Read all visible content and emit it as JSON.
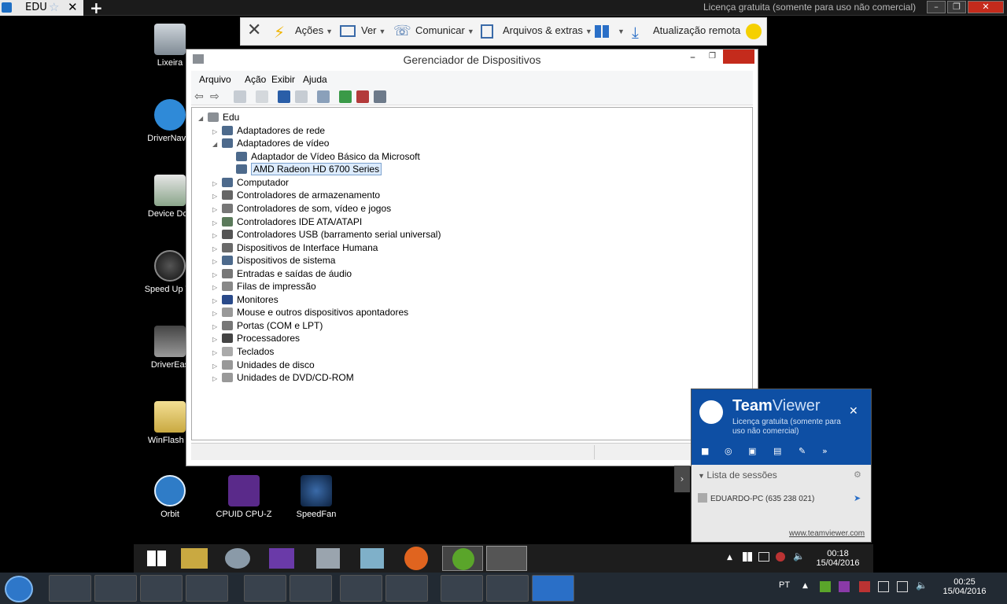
{
  "tabbar": {
    "tab_name": "EDU",
    "license_text": "Licença gratuita (somente para uso não comercial)"
  },
  "toolbar": {
    "actions": "Ações",
    "view": "Ver",
    "communicate": "Comunicar",
    "files": "Arquivos & extras",
    "remote_update": "Atualização remota"
  },
  "desktop_icons": [
    {
      "label": "Lixeira"
    },
    {
      "label": "DriverNavig"
    },
    {
      "label": "Device Doc"
    },
    {
      "label": "Speed Up Th"
    },
    {
      "label": "DriverEas"
    },
    {
      "label": "WinFlash B"
    },
    {
      "label": "Orbit"
    },
    {
      "label": "CPUID CPU-Z"
    },
    {
      "label": "SpeedFan"
    }
  ],
  "device_manager": {
    "title": "Gerenciador de Dispositivos",
    "menu": [
      "Arquivo",
      "Ação",
      "Exibir",
      "Ajuda"
    ],
    "root": "Edu",
    "nodes": [
      {
        "label": "Adaptadores de rede",
        "expanded": false
      },
      {
        "label": "Adaptadores de vídeo",
        "expanded": true
      },
      {
        "label": "Adaptador de Vídeo Básico da Microsoft",
        "child": true
      },
      {
        "label": "AMD Radeon HD 6700 Series",
        "child": true,
        "selected": true
      },
      {
        "label": "Computador",
        "expanded": false
      },
      {
        "label": "Controladores de armazenamento",
        "expanded": false
      },
      {
        "label": "Controladores de som, vídeo e jogos",
        "expanded": false
      },
      {
        "label": "Controladores IDE ATA/ATAPI",
        "expanded": false
      },
      {
        "label": "Controladores USB (barramento serial universal)",
        "expanded": false
      },
      {
        "label": "Dispositivos de Interface Humana",
        "expanded": false
      },
      {
        "label": "Dispositivos de sistema",
        "expanded": false
      },
      {
        "label": "Entradas e saídas de áudio",
        "expanded": false
      },
      {
        "label": "Filas de impressão",
        "expanded": false
      },
      {
        "label": "Monitores",
        "expanded": false
      },
      {
        "label": "Mouse e outros dispositivos apontadores",
        "expanded": false
      },
      {
        "label": "Portas (COM e LPT)",
        "expanded": false
      },
      {
        "label": "Processadores",
        "expanded": false
      },
      {
        "label": "Teclados",
        "expanded": false
      },
      {
        "label": "Unidades de disco",
        "expanded": false
      },
      {
        "label": "Unidades de DVD/CD-ROM",
        "expanded": false
      }
    ]
  },
  "teamviewer_panel": {
    "brand_a": "Team",
    "brand_b": "Viewer",
    "license": "Licença gratuita (somente para uso não comercial)",
    "list_header": "Lista de sessões",
    "session": "EDUARDO-PC (635 238 021)",
    "link": "www.teamviewer.com"
  },
  "remote_clock": {
    "time": "00:18",
    "date": "15/04/2016"
  },
  "local_clock": {
    "time": "00:25",
    "date": "15/04/2016"
  },
  "language": "PT"
}
